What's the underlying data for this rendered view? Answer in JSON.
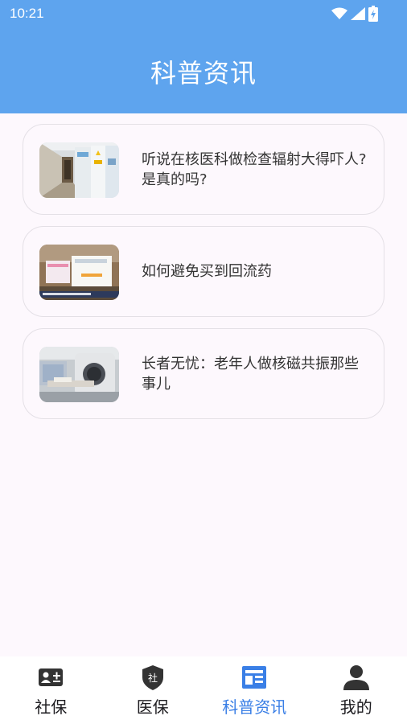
{
  "status_bar": {
    "time": "10:21",
    "icons": [
      "wifi-icon",
      "signal-icon",
      "battery-icon"
    ]
  },
  "header": {
    "title": "科普资讯"
  },
  "articles": [
    {
      "title": "听说在核医科做检查辐射大得吓人?是真的吗?",
      "thumbnail": "hospital-corridor-image"
    },
    {
      "title": "如何避免买到回流药",
      "thumbnail": "medicine-box-image"
    },
    {
      "title": "长者无忧：老年人做核磁共振那些事儿",
      "thumbnail": "mri-machine-image"
    }
  ],
  "tabbar": {
    "active_index": 2,
    "active_color": "#3a7fe6",
    "tabs": [
      {
        "label": "社保",
        "icon": "id-card-icon"
      },
      {
        "label": "医保",
        "icon": "shield-icon"
      },
      {
        "label": "科普资讯",
        "icon": "news-icon"
      },
      {
        "label": "我的",
        "icon": "person-icon"
      }
    ]
  },
  "colors": {
    "header": "#5ea4ee",
    "background": "#fdf8fd"
  }
}
